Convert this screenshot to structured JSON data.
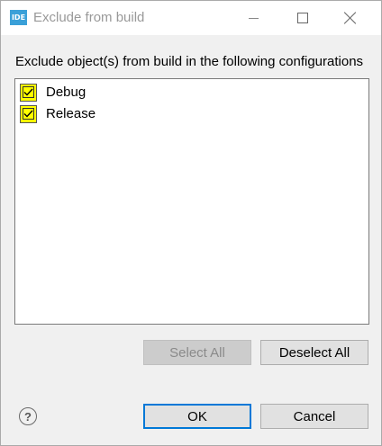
{
  "window": {
    "icon_text": "IDE",
    "title": "Exclude from build"
  },
  "description": "Exclude object(s) from build in the following configurations",
  "configurations": [
    {
      "label": "Debug",
      "checked": true
    },
    {
      "label": "Release",
      "checked": true
    }
  ],
  "buttons": {
    "select_all": "Select All",
    "deselect_all": "Deselect All",
    "ok": "OK",
    "cancel": "Cancel"
  },
  "help": {
    "glyph": "?"
  },
  "colors": {
    "checkbox_highlight": "#ffff00",
    "default_button_border": "#0078d7",
    "app_icon": "#3aa0d8"
  }
}
